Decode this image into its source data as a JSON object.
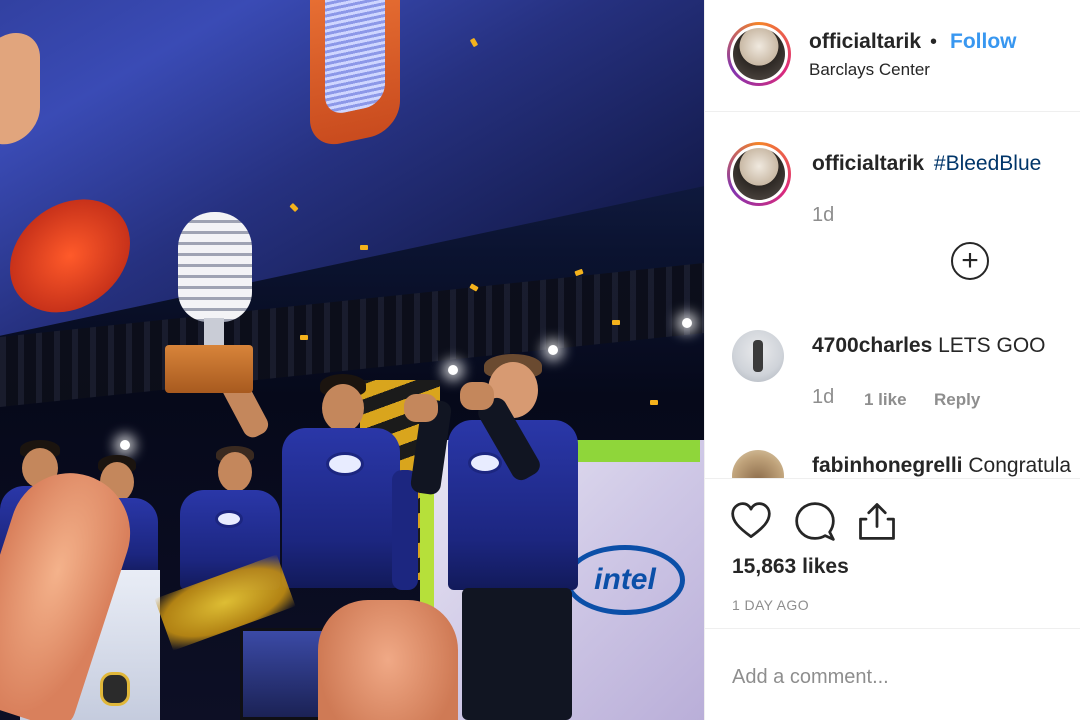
{
  "post": {
    "username": "officialtarik",
    "separator": "•",
    "follow_label": "Follow",
    "location": "Barclays Center"
  },
  "caption": {
    "username": "officialtarik",
    "hashtag": "#BleedBlue",
    "time": "1d",
    "load_more_symbol": "+"
  },
  "comments": [
    {
      "username": "4700charles",
      "text": "LETS GOO",
      "time": "1d",
      "likes": "1 like",
      "reply": "Reply"
    },
    {
      "username": "fabinhonegrelli",
      "text": "Congratula"
    }
  ],
  "actions": {
    "like_icon": "heart-icon",
    "comment_icon": "speech-bubble-icon",
    "share_icon": "share-icon"
  },
  "likes_count": "15,863 likes",
  "posted_ago": "1 DAY AGO",
  "add_comment": {
    "placeholder": "Add a comment..."
  },
  "photo_text": {
    "intel_logo": "intel"
  },
  "colors": {
    "follow_blue": "#3897f0",
    "hashtag_blue": "#003569",
    "muted_gray": "#8e8e8e",
    "text_dark": "#262626",
    "divider": "#efefef"
  }
}
